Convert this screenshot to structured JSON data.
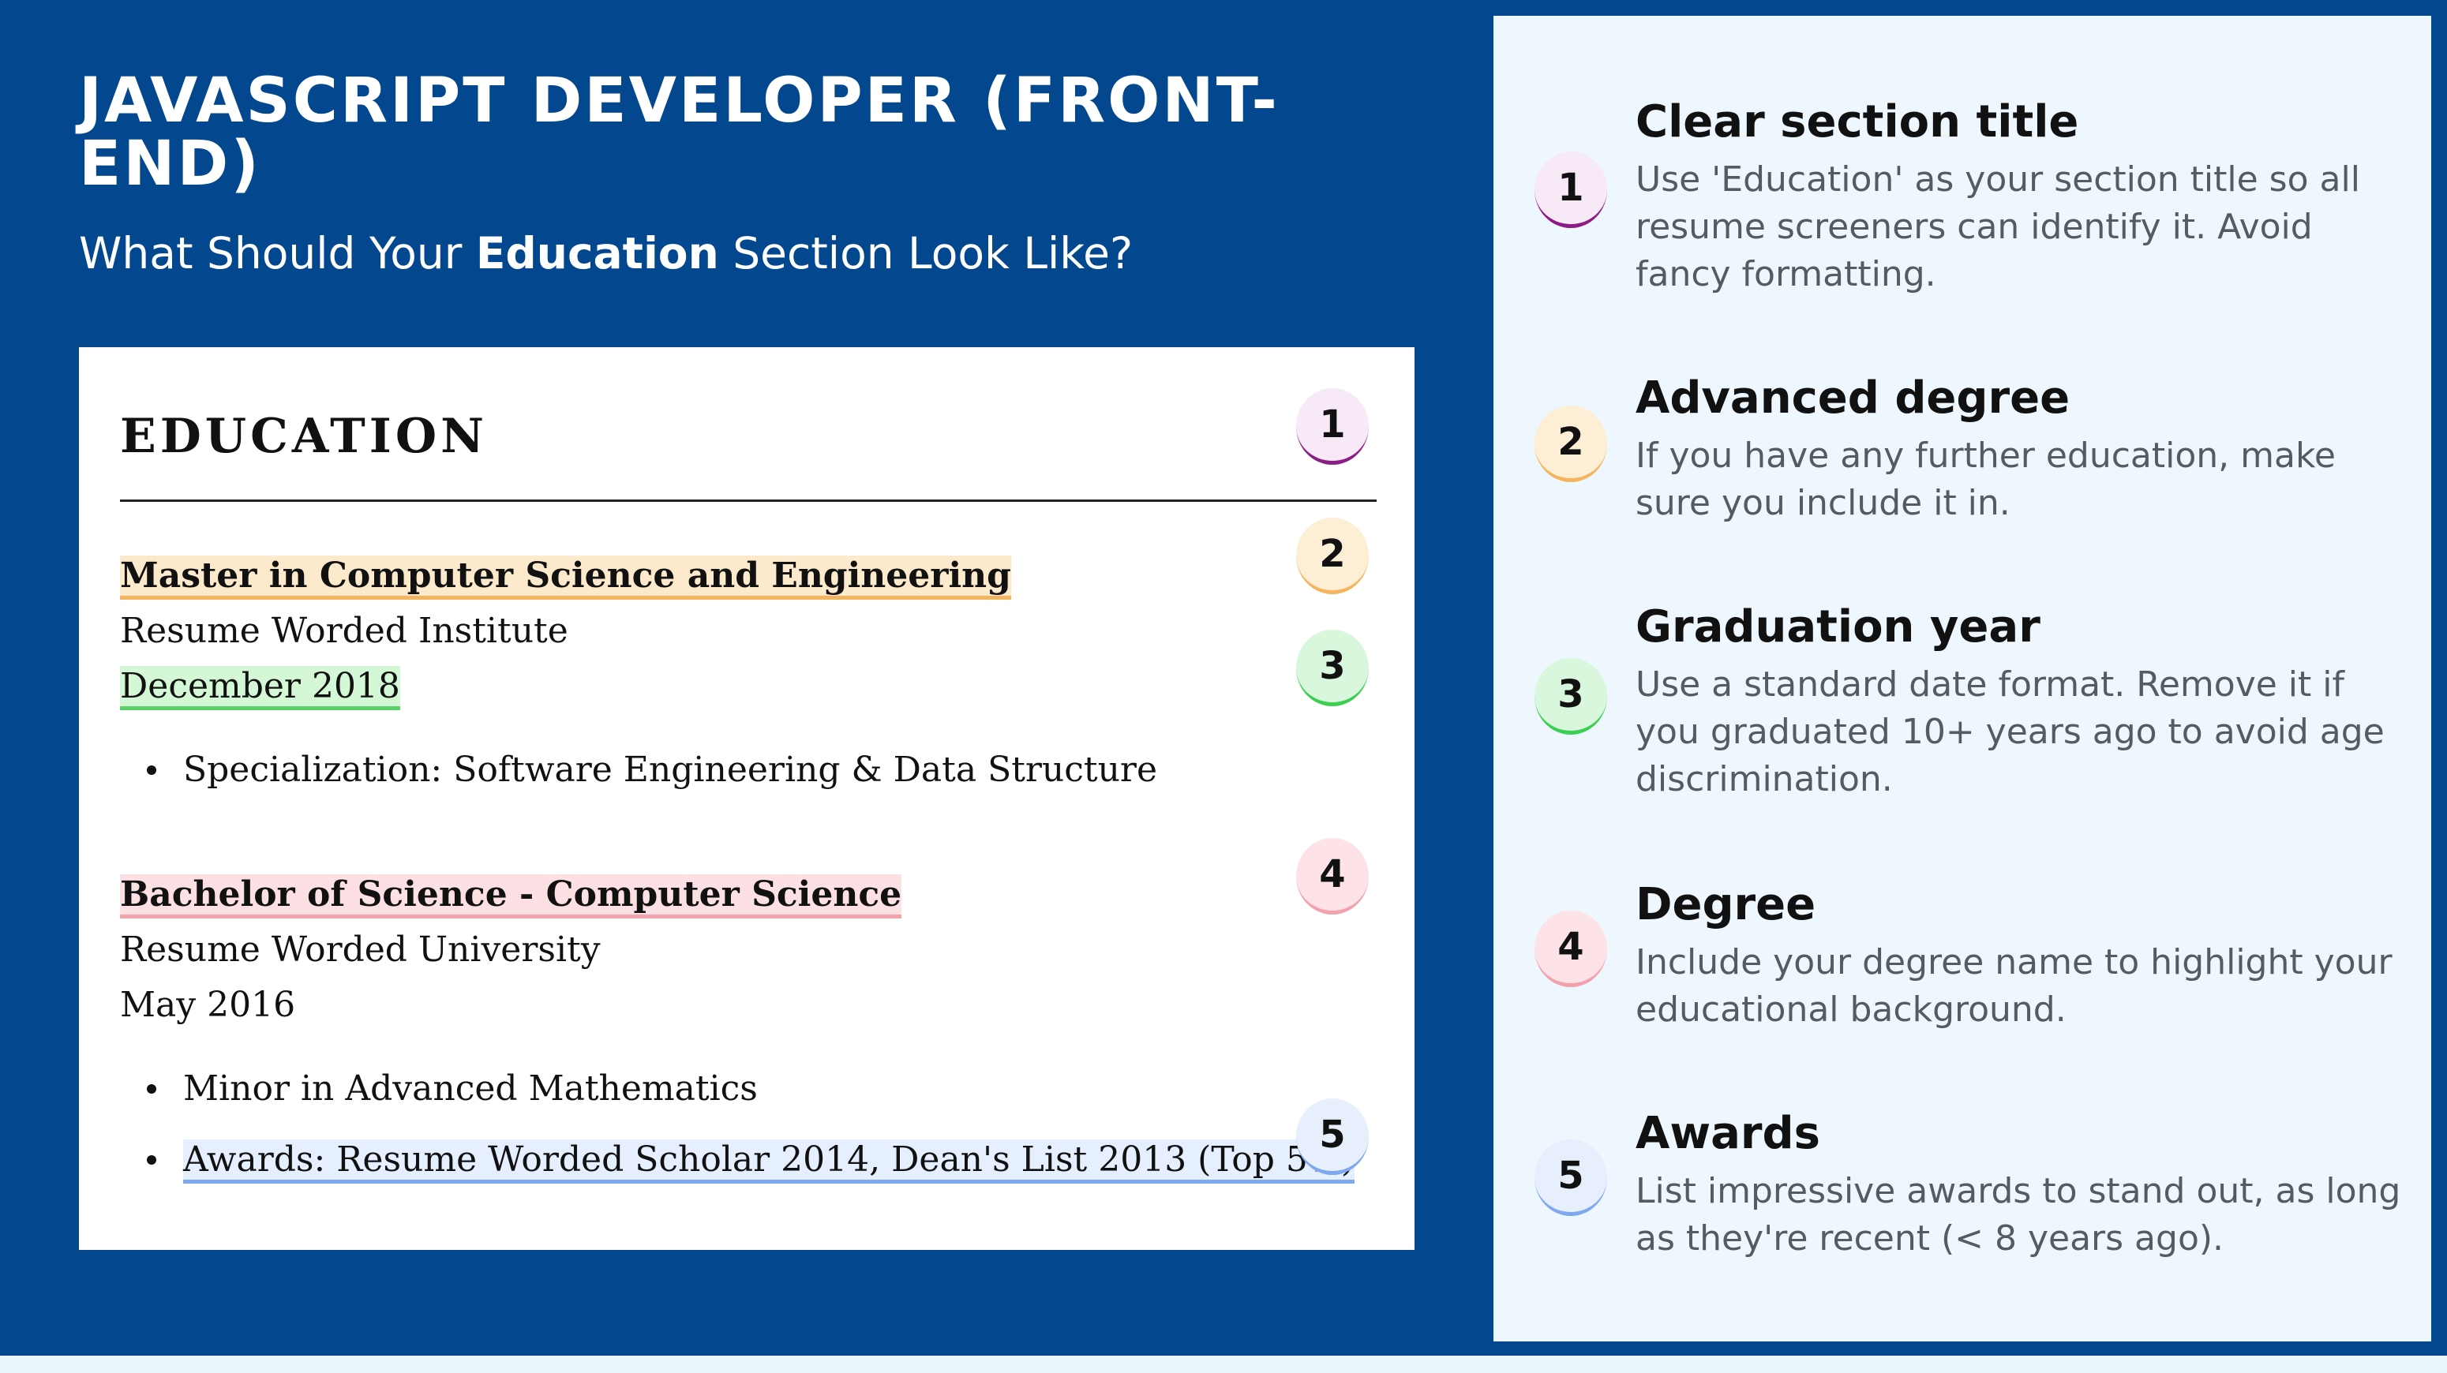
{
  "header": {
    "title": "JAVASCRIPT DEVELOPER (FRONT-END)",
    "subtitle_before": "What Should Your ",
    "subtitle_bold": "Education",
    "subtitle_after": " Section Look Like?"
  },
  "resume": {
    "section_title": "EDUCATION",
    "entries": [
      {
        "degree": "Master in Computer Science and Engineering",
        "school": "Resume Worded Institute",
        "date": "December 2018",
        "bullets": [
          "Specialization: Software Engineering & Data Structure"
        ]
      },
      {
        "degree": "Bachelor of Science - Computer Science",
        "school": "Resume Worded University",
        "date": "May 2016",
        "bullets": [
          "Minor in Advanced Mathematics",
          "Awards: Resume Worded Scholar 2014, Dean's List 2013 (Top 5%)"
        ]
      }
    ]
  },
  "badges": [
    "1",
    "2",
    "3",
    "4",
    "5"
  ],
  "tips": [
    {
      "number": "1",
      "title": "Clear section title",
      "text": "Use 'Education' as your section title so all resume screeners can identify it. Avoid fancy formatting."
    },
    {
      "number": "2",
      "title": "Advanced degree",
      "text": "If you have any further education, make sure you include it in."
    },
    {
      "number": "3",
      "title": "Graduation year",
      "text": "Use a standard date format. Remove it if you graduated 10+ years ago to avoid age discrimination."
    },
    {
      "number": "4",
      "title": "Degree",
      "text": "Include your degree name to highlight your educational background."
    },
    {
      "number": "5",
      "title": "Awards",
      "text": "List impressive awards to stand out, as long as they're recent (< 8 years ago)."
    }
  ],
  "colors": {
    "background": "#03488e",
    "panel": "#eff7fe",
    "badge_1": "#8d1d86",
    "badge_2": "#f4b55e",
    "badge_3": "#3ccf52",
    "badge_4": "#f1a2ad",
    "badge_5": "#7ea8ef"
  }
}
